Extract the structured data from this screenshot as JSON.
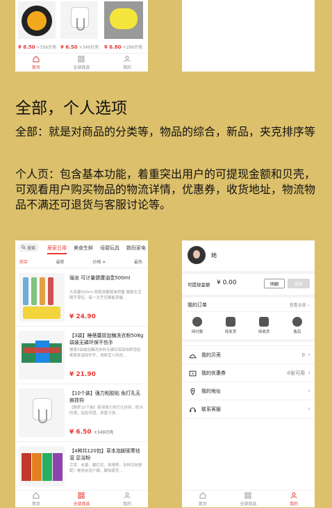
{
  "top_left_phone": {
    "prices": [
      {
        "price": "¥ 8.50",
        "shells": "+359贝壳"
      },
      {
        "price": "¥ 6.50",
        "shells": "+349贝壳"
      },
      {
        "price": "¥ 6.80",
        "shells": "+299贝壳"
      }
    ],
    "nav": [
      "首页",
      "全部商品",
      "我的"
    ]
  },
  "section": {
    "heading": "全部，个人选项",
    "para1": "全部：就是对商品的分类等，物品的综合，新品，夹克排序等",
    "para2": "个人页：包含基本功能，着重突出用户的可提现金额和贝壳，可观看用户购买物品的物流详情，优惠券，收货地址，物流物品不满还可退货与客服讨论等。"
  },
  "category_phone": {
    "search_label": "搜索",
    "tabs": [
      "居家日用",
      "美食生鲜",
      "母婴玩具",
      "数码家电"
    ],
    "filters": [
      "综合",
      "最新",
      "价格 ≑",
      "最热"
    ],
    "products": [
      {
        "title": "骊龙 可计量健康油壶500ml",
        "desc": "大容量500ml 刻度测量精准把握 健康生活随手掌控，每一次烹饪都能掌握…",
        "price": "¥ 24.90",
        "shells": ""
      },
      {
        "title": "【3袋】睡蓓蕾奴加酶洗衣粉508g袋装无磷环保不伤手",
        "desc": "睡蓓3袋装加酶洗衣粉无磷环保高效舒适轻柔肌肤温和护手，清新宜人的洗…",
        "price": "¥ 21.90",
        "shells": ""
      },
      {
        "title": "【10个装】强力粘胶贴 免打孔无痕挂钩",
        "desc": "【厨房10个装】家用强力免打孔挂钩，防水防潮，粘贴牢固，承重力强…",
        "price": "¥ 6.50",
        "shells": "+349贝壳"
      },
      {
        "title": "【4种共120包】草本泡脚驱寒祛湿 足浴粉",
        "desc": "艾草、老姜、藏红花、玫瑰等，多种功效搭配！睡觉前泡个脚，解除疲劳…",
        "price": "",
        "shells": ""
      }
    ],
    "nav": [
      "首页",
      "全部商品",
      "我的"
    ]
  },
  "profile_phone": {
    "username": "她",
    "withdraw_label": "可提现金额",
    "withdraw_value": "¥ 0.00",
    "detail_btn": "明细",
    "withdraw_btn": "提现",
    "orders_title": "我的订单",
    "orders_all": "查看全部",
    "order_items": [
      "待付款",
      "待发货",
      "待收货",
      "售后"
    ],
    "rows": [
      {
        "label": "我的贝壳",
        "value": "0"
      },
      {
        "label": "我的优惠券",
        "value": "0张可用"
      },
      {
        "label": "我的地址",
        "value": ""
      },
      {
        "label": "联系客服",
        "value": ""
      }
    ],
    "nav": [
      "首页",
      "全部商品",
      "我的"
    ]
  }
}
